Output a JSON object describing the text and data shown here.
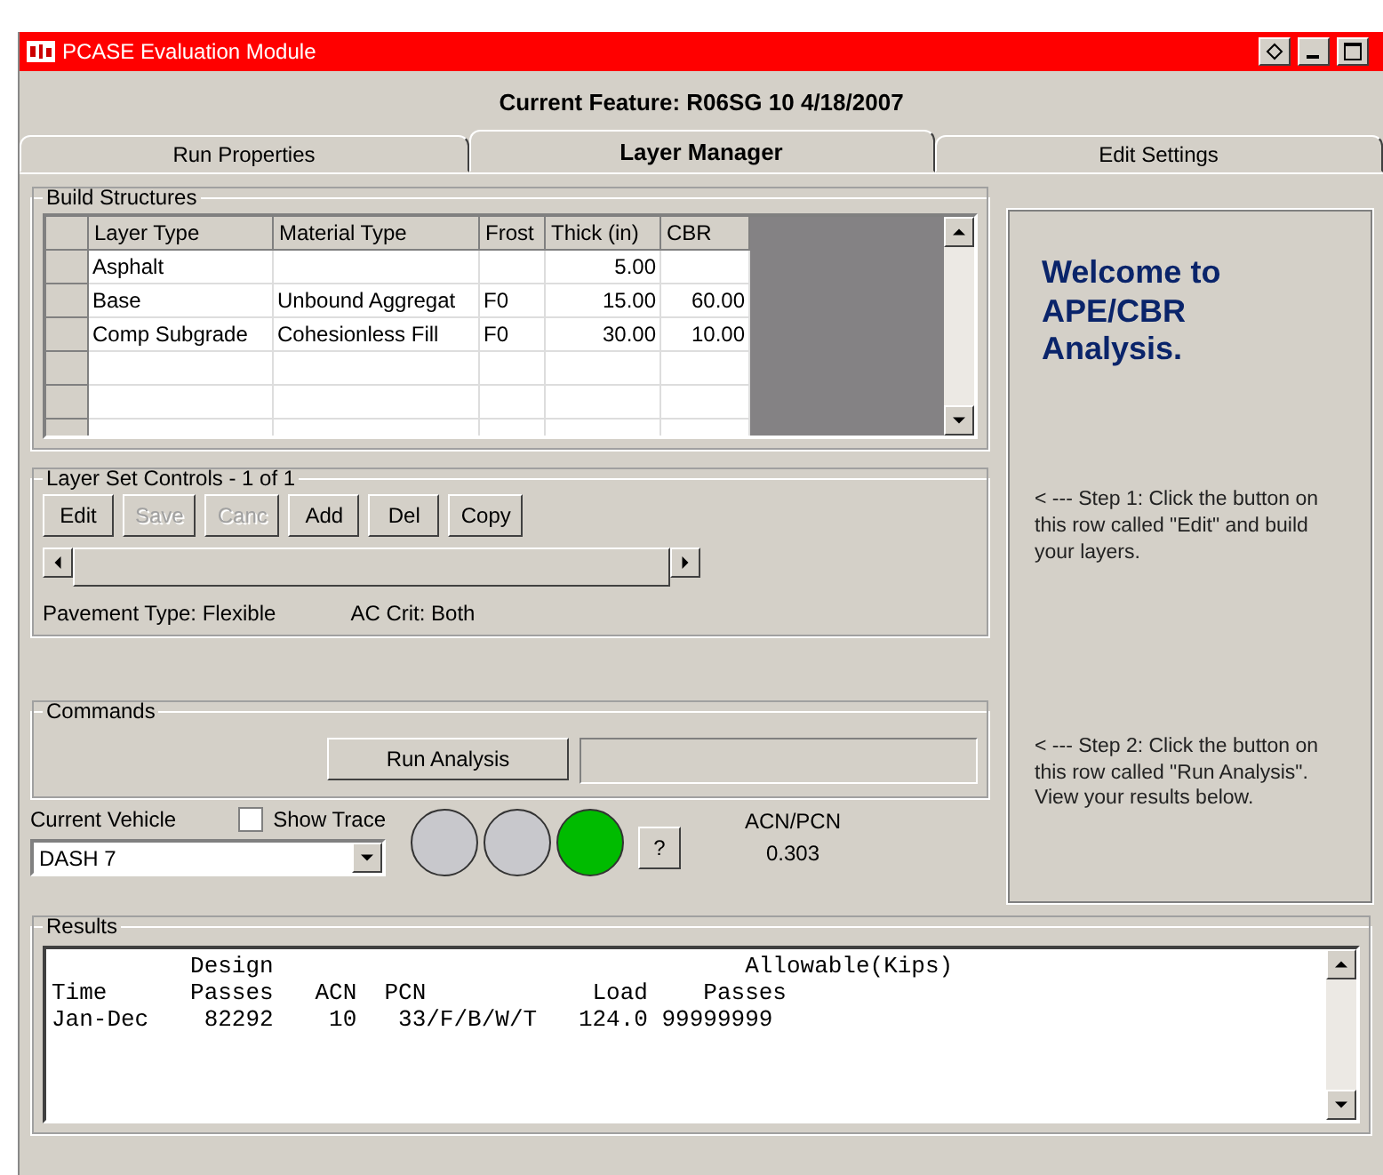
{
  "window": {
    "title": "PCASE Evaluation Module"
  },
  "current_feature": "Current Feature: R06SG 10 4/18/2007",
  "tabs": [
    {
      "label": "Run Properties",
      "selected": false
    },
    {
      "label": "Layer Manager",
      "selected": true
    },
    {
      "label": "Edit Settings",
      "selected": false
    }
  ],
  "build_structures": {
    "title": "Build Structures",
    "columns": [
      "Layer Type",
      "Material Type",
      "Frost",
      "Thick (in)",
      "CBR"
    ],
    "rows": [
      [
        "Asphalt",
        "",
        "",
        "5.00",
        ""
      ],
      [
        "Base",
        "Unbound Aggregat",
        "F0",
        "15.00",
        "60.00"
      ],
      [
        "Comp Subgrade",
        "Cohesionless Fill",
        "F0",
        "30.00",
        "10.00"
      ],
      [
        "",
        "",
        "",
        "",
        ""
      ],
      [
        "",
        "",
        "",
        "",
        ""
      ],
      [
        "",
        "",
        "",
        "",
        ""
      ]
    ]
  },
  "layer_set_controls": {
    "title": "Layer Set Controls -  1 of  1",
    "buttons": [
      {
        "label": "Edit",
        "disabled": false
      },
      {
        "label": "Save",
        "disabled": true
      },
      {
        "label": "Canc",
        "disabled": true
      },
      {
        "label": "Add",
        "disabled": false
      },
      {
        "label": "Del",
        "disabled": false
      },
      {
        "label": "Copy",
        "disabled": false
      }
    ],
    "pavement_type": "Pavement Type: Flexible",
    "ac_crit": "AC Crit: Both"
  },
  "commands": {
    "title": "Commands",
    "run_button": "Run Analysis"
  },
  "vehicle": {
    "label": "Current Vehicle",
    "value": "DASH 7",
    "show_trace": {
      "label": "Show Trace",
      "checked": false
    },
    "lights": [
      {
        "color": "#c8c8cc"
      },
      {
        "color": "#c8c8cc"
      },
      {
        "color": "#00bb00"
      }
    ],
    "help": "?",
    "acn_pcn_label": "ACN/PCN",
    "acn_pcn_value": "0.303"
  },
  "welcome": {
    "title": "Welcome to APE/CBR Analysis.",
    "step_1": "< ---  Step 1: Click the button on this row called \"Edit\" and build your layers.",
    "step_2": "< ---  Step 2: Click the button on this row called \"Run Analysis\". View your results below."
  },
  "results": {
    "title": "Results",
    "lines": [
      "          Design                                  Allowable(Kips)",
      "Time      Passes   ACN  PCN            Load    Passes",
      "Jan-Dec    82292    10   33/F/B/W/T   124.0 99999999"
    ]
  }
}
